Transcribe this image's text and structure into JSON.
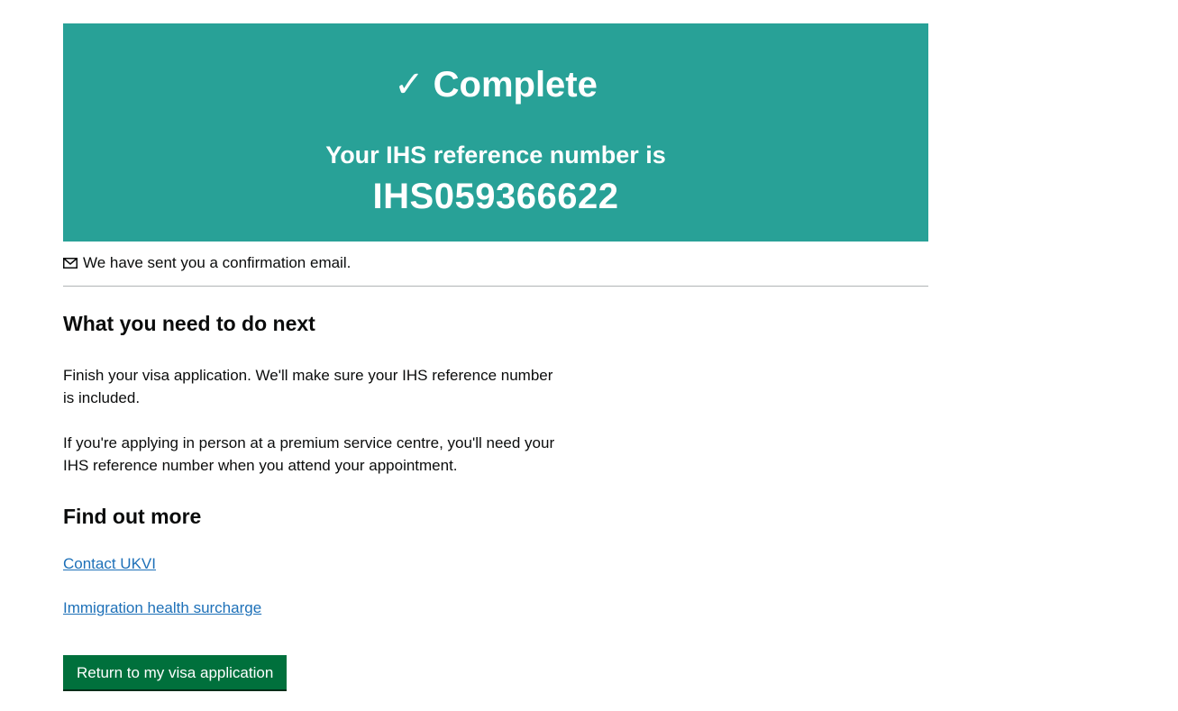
{
  "panel": {
    "tick_icon": "✓",
    "title": "Complete",
    "subtitle": "Your IHS reference number is",
    "reference": "IHS059366622"
  },
  "email_notice": {
    "icon": "mail-icon",
    "text": "We have sent you a confirmation email."
  },
  "next_steps": {
    "heading": "What you need to do next",
    "paragraph_1": "Finish your visa application. We'll make sure your IHS reference number is included.",
    "paragraph_2": "If you're applying in person at a premium service centre, you'll need your IHS reference number when you attend your appointment."
  },
  "find_out_more": {
    "heading": "Find out more",
    "links": [
      {
        "label": "Contact UKVI"
      },
      {
        "label": "Immigration health surcharge"
      }
    ]
  },
  "return_button": {
    "label": "Return to my visa application"
  },
  "colors": {
    "panel_bg": "#28a197",
    "link": "#1d70b8",
    "button_bg": "#00703c",
    "divider": "#b1b4b6"
  }
}
